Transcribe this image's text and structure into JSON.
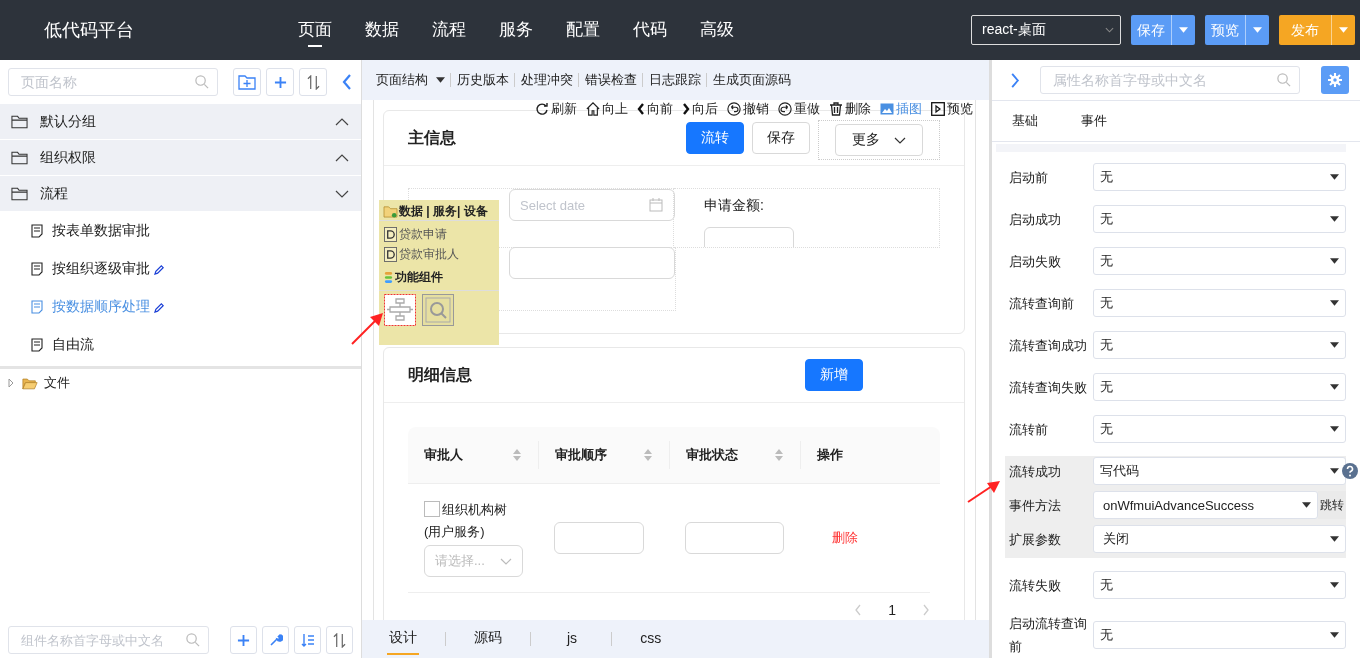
{
  "topbar": {
    "logo": "低代码平台",
    "nav": [
      {
        "label": "页面",
        "selected": true
      },
      {
        "label": "数据",
        "selected": false
      },
      {
        "label": "流程",
        "selected": false
      },
      {
        "label": "服务",
        "selected": false
      },
      {
        "label": "配置",
        "selected": false
      },
      {
        "label": "代码",
        "selected": false
      },
      {
        "label": "高级",
        "selected": false
      }
    ],
    "env_select": {
      "value": "react-桌面"
    },
    "actions": [
      {
        "label": "保存",
        "color": "#5b9cf6"
      },
      {
        "label": "预览",
        "color": "#5b9cf6"
      },
      {
        "label": "发布",
        "color": "#f5a623"
      }
    ]
  },
  "sidebar": {
    "search": {
      "placeholder": "页面名称"
    },
    "groups": [
      {
        "label": "默认分组",
        "expanded": false
      },
      {
        "label": "组织权限",
        "expanded": false
      },
      {
        "label": "流程",
        "expanded": true,
        "children": [
          {
            "label": "按表单数据审批",
            "selected": false,
            "editable": false
          },
          {
            "label": "按组织逐级审批",
            "selected": false,
            "editable": true
          },
          {
            "label": "按数据顺序处理",
            "selected": true,
            "editable": true
          },
          {
            "label": "自由流",
            "selected": false,
            "editable": false
          }
        ]
      }
    ],
    "files": [
      {
        "label": "文件",
        "expanded": false
      }
    ],
    "component_search": {
      "placeholder": "组件名称首字母或中文名"
    }
  },
  "editor": {
    "menu": [
      {
        "label": "页面结构",
        "dropdown": true
      },
      {
        "label": "历史版本",
        "dropdown": false
      },
      {
        "label": "处理冲突",
        "dropdown": false
      },
      {
        "label": "错误检查",
        "dropdown": false
      },
      {
        "label": "日志跟踪",
        "dropdown": false
      },
      {
        "label": "生成页面源码",
        "dropdown": false
      }
    ],
    "tools": [
      {
        "kind": "refresh",
        "label": "刷新",
        "active": false
      },
      {
        "kind": "home",
        "label": "向上",
        "active": false
      },
      {
        "kind": "back",
        "label": "向前",
        "active": false
      },
      {
        "kind": "forward",
        "label": "向后",
        "active": false
      },
      {
        "kind": "undo",
        "label": "撤销",
        "active": false
      },
      {
        "kind": "redo",
        "label": "重做",
        "active": false
      },
      {
        "kind": "delete",
        "label": "删除",
        "active": false
      },
      {
        "kind": "image",
        "label": "插图",
        "active": true
      },
      {
        "kind": "preview",
        "label": "预览",
        "active": false
      }
    ],
    "main_card": {
      "title": "主信息",
      "buttons": [
        {
          "label": "流转",
          "kind": "primary"
        },
        {
          "label": "保存",
          "kind": "default"
        },
        {
          "label": "更多",
          "kind": "menu"
        }
      ],
      "date_field": {
        "placeholder": "Select date"
      },
      "amount_label": "申请金额:"
    },
    "popup": {
      "header": "数据 | 服务| 设备",
      "data_items": [
        "贷款申请",
        "贷款审批人"
      ],
      "section": "功能组件",
      "components": [
        {
          "kind": "flow",
          "selected": true
        },
        {
          "kind": "search",
          "selected": false
        }
      ]
    },
    "detail_card": {
      "title": "明细信息",
      "add_button": "新增",
      "columns": [
        {
          "label": "审批人",
          "sortable": true
        },
        {
          "label": "审批顺序",
          "sortable": true
        },
        {
          "label": "审批状态",
          "sortable": true
        },
        {
          "label": "操作",
          "sortable": false
        }
      ],
      "row": {
        "checked": false,
        "tree_label": "组织机构树(用户服务)",
        "select_placeholder": "请选择...",
        "action": "删除"
      },
      "page": "1"
    },
    "bottom_tabs": [
      {
        "label": "设计",
        "selected": true
      },
      {
        "label": "源码",
        "selected": false
      },
      {
        "label": "js",
        "selected": false
      },
      {
        "label": "css",
        "selected": false
      }
    ]
  },
  "properties": {
    "search": {
      "placeholder": "属性名称首字母或中文名"
    },
    "tabs": [
      "基础",
      "事件"
    ],
    "events": [
      {
        "label": "启动前",
        "value": "无",
        "highlighted": false,
        "help": false
      },
      {
        "label": "启动成功",
        "value": "无",
        "highlighted": false,
        "help": false
      },
      {
        "label": "启动失败",
        "value": "无",
        "highlighted": false,
        "help": false
      },
      {
        "label": "流转查询前",
        "value": "无",
        "highlighted": false,
        "help": false
      },
      {
        "label": "流转查询成功",
        "value": "无",
        "highlighted": false,
        "help": false
      },
      {
        "label": "流转查询失败",
        "value": "无",
        "highlighted": false,
        "help": false
      },
      {
        "label": "流转前",
        "value": "无",
        "highlighted": false,
        "help": false
      },
      {
        "label": "流转成功",
        "value": "写代码",
        "highlighted": true,
        "help": true,
        "details": [
          {
            "label": "事件方法",
            "value": "onWfmuiAdvanceSuccess",
            "action": "跳转"
          },
          {
            "label": "扩展参数",
            "value": "关闭"
          }
        ]
      },
      {
        "label": "流转失败",
        "value": "无",
        "highlighted": false,
        "help": false
      },
      {
        "label": "启动流转查询前",
        "value": "无",
        "highlighted": false,
        "help": false
      }
    ]
  }
}
